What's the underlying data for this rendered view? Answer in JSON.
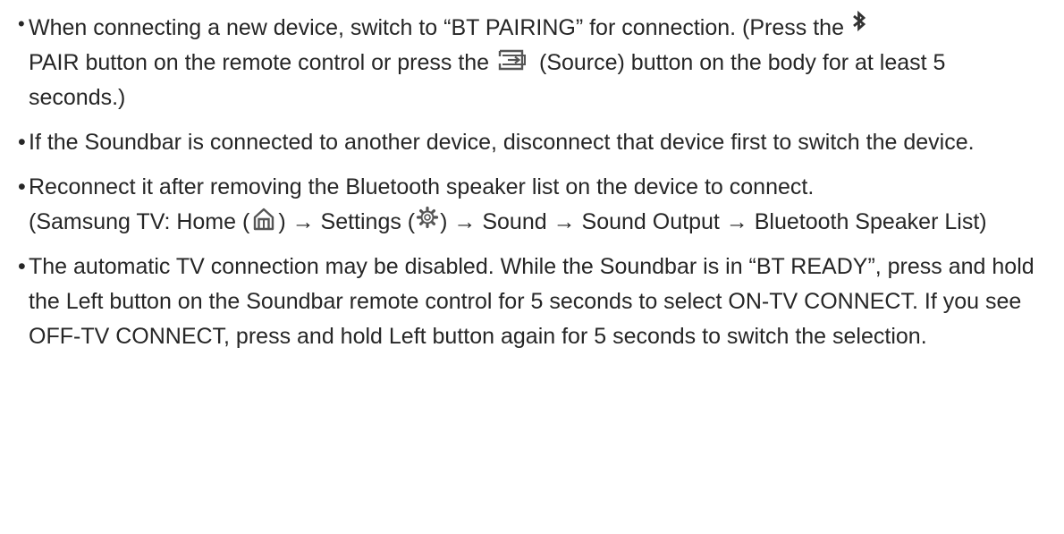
{
  "document": {
    "bullets": [
      {
        "segments": [
          "When connecting a new device, switch to “BT PAIRING” for connection. (Press the",
          "PAIR button on the remote control or press the",
          "(Source) button on the body for at least 5 seconds.)"
        ]
      },
      {
        "text": "If the Soundbar is connected to another device, disconnect that device first to switch the device."
      },
      {
        "segments": [
          "Reconnect it after removing the Bluetooth speaker list on the device to connect.",
          "(Samsung TV: Home (",
          ") → Settings (",
          ") → Sound → Sound Output → Bluetooth Speaker List)"
        ]
      },
      {
        "text": "The automatic TV connection may be disabled. While the Soundbar is in “BT READY”, press and hold the Left button on the Soundbar remote control for 5 seconds to select ON-TV CONNECT. If you see OFF-TV CONNECT, press and hold Left button again for 5 seconds to switch the selection."
      }
    ],
    "icons": {
      "bluetooth": "bluetooth-icon",
      "source": "source-icon",
      "home": "home-icon",
      "settings": "settings-gear-icon"
    },
    "colors": {
      "text": "#262626",
      "icon": "#555555"
    }
  }
}
